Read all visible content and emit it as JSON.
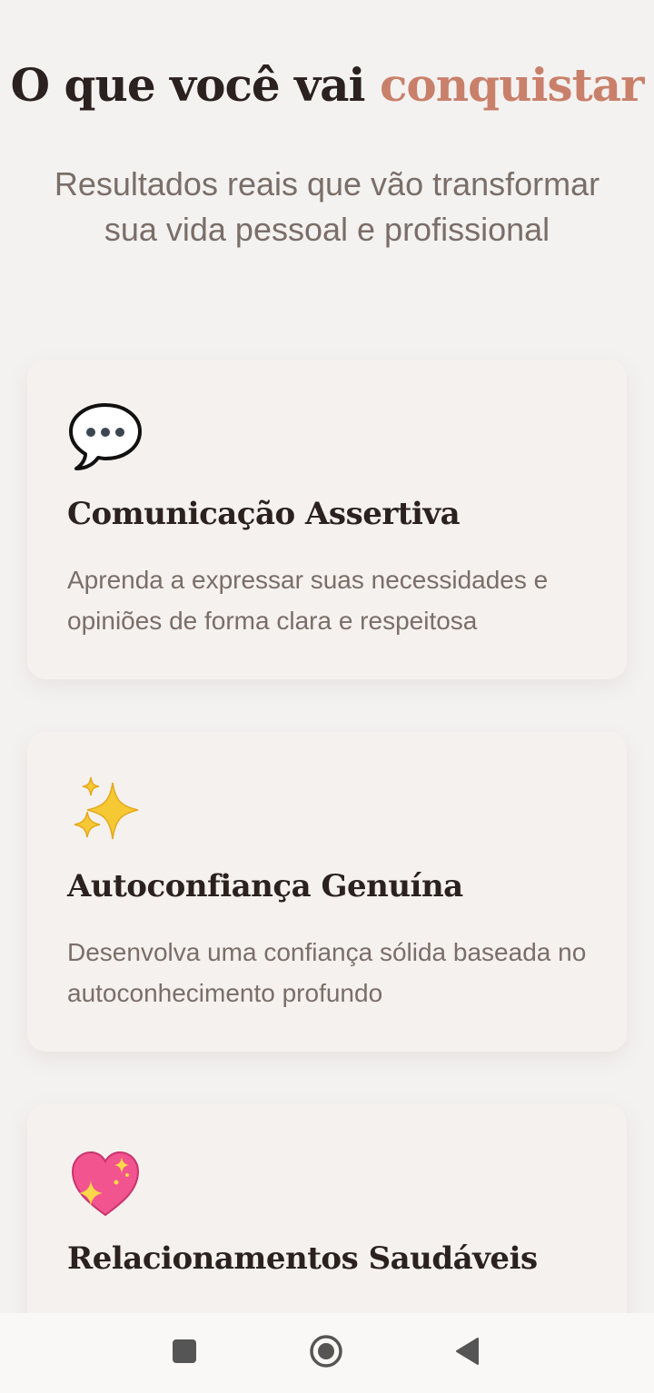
{
  "header": {
    "title_main": "O que você vai",
    "title_accent": "conquistar",
    "subtitle": "Resultados reais que vão transformar sua vida pessoal e profissional"
  },
  "cards": [
    {
      "icon": "speech-bubble-icon",
      "title": "Comunicação Assertiva",
      "description": "Aprenda a expressar suas necessidades e opiniões de forma clara e respeitosa"
    },
    {
      "icon": "sparkles-icon",
      "title": "Autoconfiança Genuína",
      "description": "Desenvolva uma confiança sólida baseada no autoconhecimento profundo"
    },
    {
      "icon": "sparkling-heart-icon",
      "title": "Relacionamentos Saudáveis",
      "description": ""
    }
  ],
  "colors": {
    "background": "#f4f2f1",
    "card": "#f5f1ef",
    "accent": "#c9806b",
    "heading": "#2b2220",
    "body_text": "#7a6e68"
  },
  "navbar": {
    "buttons": [
      "recent-apps-icon",
      "home-icon",
      "back-icon"
    ]
  }
}
